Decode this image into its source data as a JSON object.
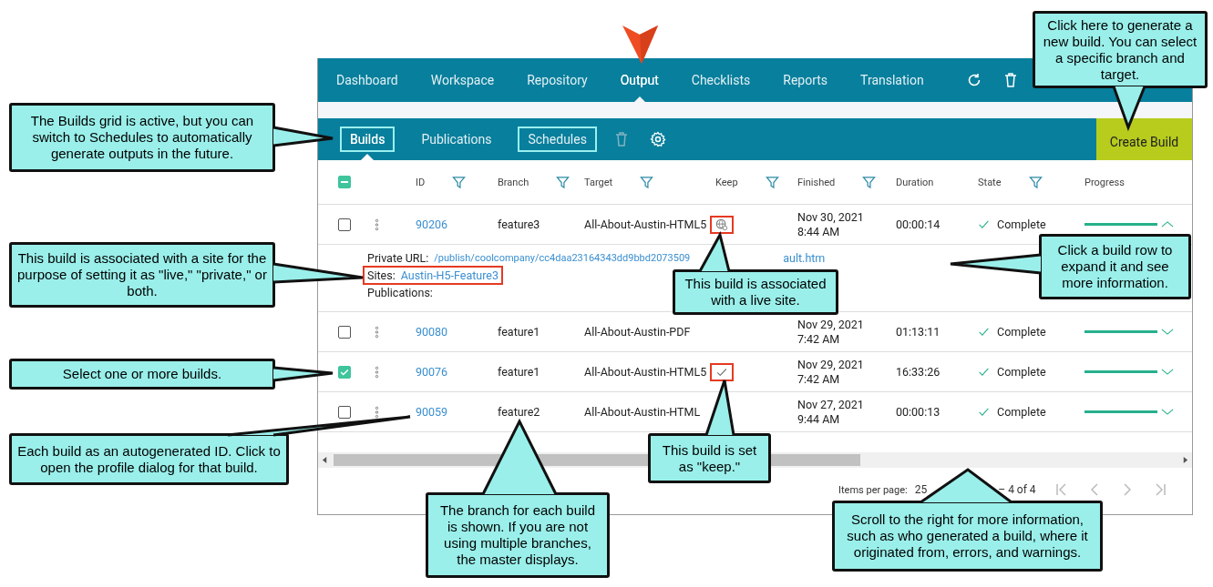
{
  "nav": {
    "items": [
      {
        "label": "Dashboard",
        "selected": false
      },
      {
        "label": "Workspace",
        "selected": false
      },
      {
        "label": "Repository",
        "selected": false
      },
      {
        "label": "Output",
        "selected": true
      },
      {
        "label": "Checklists",
        "selected": false
      },
      {
        "label": "Reports",
        "selected": false
      },
      {
        "label": "Translation",
        "selected": false
      }
    ]
  },
  "subtabs": [
    {
      "label": "Builds",
      "selected": true,
      "framed": true
    },
    {
      "label": "Publications",
      "selected": false,
      "framed": false
    },
    {
      "label": "Schedules",
      "selected": false,
      "framed": true
    }
  ],
  "create_button": "Create Build",
  "table": {
    "header_indeterminate": true,
    "columns": [
      {
        "label": "ID",
        "filter": true
      },
      {
        "label": "Branch",
        "filter": true
      },
      {
        "label": "Target",
        "filter": true
      },
      {
        "label": "Keep",
        "filter": true
      },
      {
        "label": "Finished",
        "filter": true
      },
      {
        "label": "Duration",
        "filter": false
      },
      {
        "label": "State",
        "filter": true
      },
      {
        "label": "Progress",
        "filter": false
      }
    ],
    "rows": [
      {
        "checked": false,
        "id": "90206",
        "branch": "feature3",
        "target": "All-About-Austin-HTML5",
        "live_site": true,
        "keep": false,
        "finished": [
          "Nov 30, 2021",
          "8:44 AM"
        ],
        "duration": "00:00:14",
        "state": "Complete",
        "level": 1,
        "expanded": true
      },
      {
        "checked": false,
        "id": "90080",
        "branch": "feature1",
        "target": "All-About-Austin-PDF",
        "live_site": false,
        "keep": false,
        "finished": [
          "Nov 29, 2021",
          "7:42 AM"
        ],
        "duration": "01:13:11",
        "state": "Complete",
        "level": 1,
        "expanded": false
      },
      {
        "checked": true,
        "id": "90076",
        "branch": "feature1",
        "target": "All-About-Austin-HTML5",
        "live_site": false,
        "keep": true,
        "finished": [
          "Nov 29, 2021",
          "7:42 AM"
        ],
        "duration": "16:33:26",
        "state": "Complete",
        "level": 1,
        "expanded": false
      },
      {
        "checked": false,
        "id": "90059",
        "branch": "feature2",
        "target": "All-About-Austin-HTML",
        "live_site": false,
        "keep": false,
        "finished": [
          "Nov 27, 2021",
          "9:44 AM"
        ],
        "duration": "00:00:13",
        "state": "Complete",
        "level": 1,
        "expanded": false
      }
    ],
    "detail": {
      "url_label": "Private URL:",
      "url_start": "/publish/coolcompany/cc4daa23164343dd9bbd2073509",
      "url_end": "ault.htm",
      "sites_label": "Sites:",
      "site": "Austin-H5-Feature3",
      "sites_highlighted": true,
      "publications_label": "Publications:"
    }
  },
  "pagination": {
    "items_label": "Items per page:",
    "items_value": "25",
    "range": "– 4 of 4"
  },
  "callouts": [
    "Click here to generate a new build. You can select a specific branch and target.",
    "The Builds grid is active, but you can switch to Schedules to automatically generate outputs in the future.",
    "This build is associated with a site for the purpose of setting it as \"live,\" \"private,\" or both.",
    "This build is associated with a live site.",
    "Click a build row to expand it and see more information.",
    "Select one or more builds.",
    "Each build as an autogenerated ID. Click to open the profile dialog for that build.",
    "This build is set as \"keep.\"",
    "The branch for each build is shown. If you are not using multiple branches, the master displays.",
    "Scroll to the right for more information, such as who generated a build, where it originated from, errors, and warnings."
  ]
}
